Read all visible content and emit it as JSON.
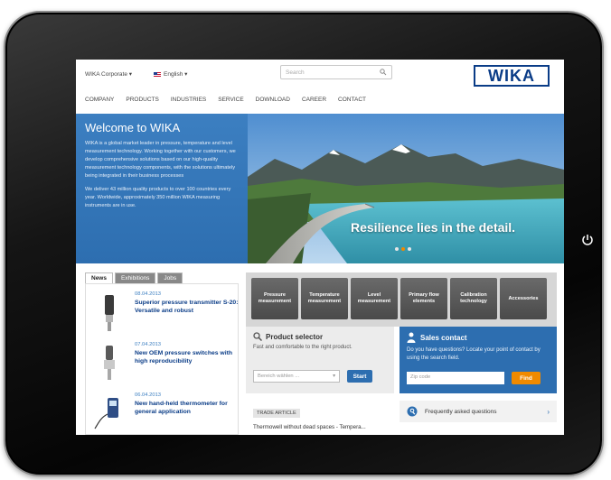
{
  "header": {
    "corporate_label": "WIKA Corporate ▾",
    "language_label": "English ▾",
    "search_placeholder": "Search",
    "logo_text": "WIKA"
  },
  "nav": [
    "COMPANY",
    "PRODUCTS",
    "INDUSTRIES",
    "SERVICE",
    "DOWNLOAD",
    "CAREER",
    "CONTACT"
  ],
  "welcome": {
    "title": "Welcome to WIKA",
    "para1": "WIKA is a global market leader in pressure, temperature and level measurement technology. Working together with our customers, we develop comprehensive solutions based on our high-quality measurement technology components, with the solutions ultimately being integrated in their business processes",
    "para2": "We deliver 43 million quality products to over 100 countries every year. Worldwide, approximately 350 million WIKA measuring instruments are in use."
  },
  "hero": {
    "caption": "Resilience lies in the detail."
  },
  "news": {
    "tabs": [
      "News",
      "Exhibitions",
      "Jobs"
    ],
    "items": [
      {
        "date": "08.04.2013",
        "title": "Superior pressure transmitter S-20: Versatile and robust"
      },
      {
        "date": "07.04.2013",
        "title": "New OEM pressure switches with high reproducibility"
      },
      {
        "date": "06.04.2013",
        "title": "New hand-held thermometer for general application"
      }
    ]
  },
  "categories": [
    "Pressure measurement",
    "Temperature measurement",
    "Level measurement",
    "Primary flow elements",
    "Calibration technology",
    "Accessories"
  ],
  "product_selector": {
    "title": "Product selector",
    "description": "Fast and comfortable to the right product.",
    "field_placeholder": "Bereich wählen ...",
    "button": "Start"
  },
  "sales_contact": {
    "title": "Sales contact",
    "description": "Do you have questions? Locate your point of contact by using the search field.",
    "zip_placeholder": "Zip code",
    "button": "Find"
  },
  "article": {
    "tag": "TRADE ARTICLE",
    "text": "Thermowell without dead spaces - Tempera..."
  },
  "faq": {
    "label": "Frequently asked questions"
  }
}
